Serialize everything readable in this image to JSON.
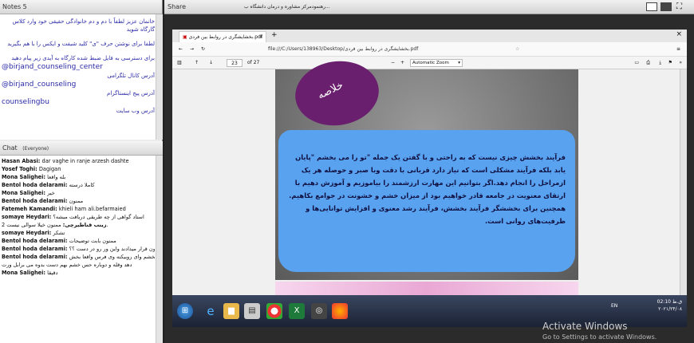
{
  "notes": {
    "header": "Notes 5",
    "line1": "خانمان عزیز لطفاً با دم و دم خانوادگی حقیقی خود وارد کلاس گارگاه شوید",
    "line2": "لطفا برای نوشتن حرف \"ی\" کلید شیفت و ایکس را با هم بگیرید",
    "line3": "برای دسترسی به فایل ضبط شده کارگاه به آیدی زیر پیام دهید",
    "handle1": "@birjand_counseling_center",
    "handle1_label": "آدرس کانال تلگرامی",
    "handle2": "@birjand_counseling",
    "handle2_label": "آدرس پیج اینستاگرام",
    "site": "counselingbu",
    "site_label": "آدرس وب سایت"
  },
  "chat": {
    "header": "Chat",
    "scope": "(Everyone)",
    "messages": [
      {
        "who": "Hasan Abasi:",
        "text": "dar vaghe in ranje arzesh dashte"
      },
      {
        "who": "Yosef Toghi:",
        "text": "Dagigan"
      },
      {
        "who": "Mona Salighei:",
        "text": "بله واقعا"
      },
      {
        "who": "Bentol hoda delarami:",
        "text": "کاملا درسته"
      },
      {
        "who": "Mona Salighei:",
        "text": "خیر"
      },
      {
        "who": "Bentol hoda delarami:",
        "text": "ممنون"
      },
      {
        "who": "Fatemeh Kamandi:",
        "text": "khieli ham ali.befarmaied"
      },
      {
        "who": "somaye Heydari:",
        "text": "استاد گواهی از چه طریقی دریافت میشه؟"
      },
      {
        "who": "زینب قناطیرچی:",
        "text": "ممنون خیلا سوالی نیست 2."
      },
      {
        "who": "somaye Heydari:",
        "text": "تشکر"
      },
      {
        "who": "Bentol hoda delarami:",
        "text": "ممنون بابت توضیحات"
      },
      {
        "who": "Bentol hoda delarami:",
        "text": "ذکر ذبای روئی ممنون قرار میدادند واین ور رو در دست ؟؟"
      },
      {
        "who": "Bentol hoda delarami:",
        "text": "ر دارائ ویبخشم وای روبیکنه وی فرس واقعا بخش"
      },
      {
        "who": "",
        "text": "دهد وقله و دوباره حس خشم بهم دست بدوه می برابل ورت"
      },
      {
        "who": "Mona Salighei:",
        "text": "دقیقا"
      }
    ]
  },
  "share": {
    "header": "Share",
    "title": "رهنمودمرکز مشاوره و درمان دانشگاه ب..."
  },
  "browser": {
    "tab_title": "بخشایشگری در روابط بین فردی.pdf",
    "address": "file:///C:/Users/138963/Desktop/بخشایشگری در روابط بین فردی.pdf",
    "page_current": "23",
    "page_total": "of 27",
    "zoom": "Automatic Zoom"
  },
  "slide": {
    "heading": "خلاصه",
    "body": "فرآیند بخشش چیزی نیست که به راحتی و با گفتن یک جمله \"تو را می بخشم \"پایان یابد بلکه فرآیند مشکلی است که نیاز دارد قربانی با دقت وبا صبر و حوصله هر یک ازمراحل را انجام دهد.اگر بتوانیم این مهارت ارزشمند را بیاموزیم و آموزش دهیم با ارتقای معنویت در جامعه قادر خواهیم بود از میزان خشم و خشونت در جوامع بکاهیم. همچنین برای بخششگر فرآیند بخشش، فرآیند رشد معنوی و افزایش توانایی‌ها و ظرفیت‌های روانی است."
  },
  "taskbar": {
    "lang": "EN",
    "time": "02:10 ق.ظ",
    "date": "۲۰۲۱/۲۴/۰۸"
  },
  "activate": {
    "title": "Activate Windows",
    "sub": "Go to Settings to activate Windows."
  }
}
